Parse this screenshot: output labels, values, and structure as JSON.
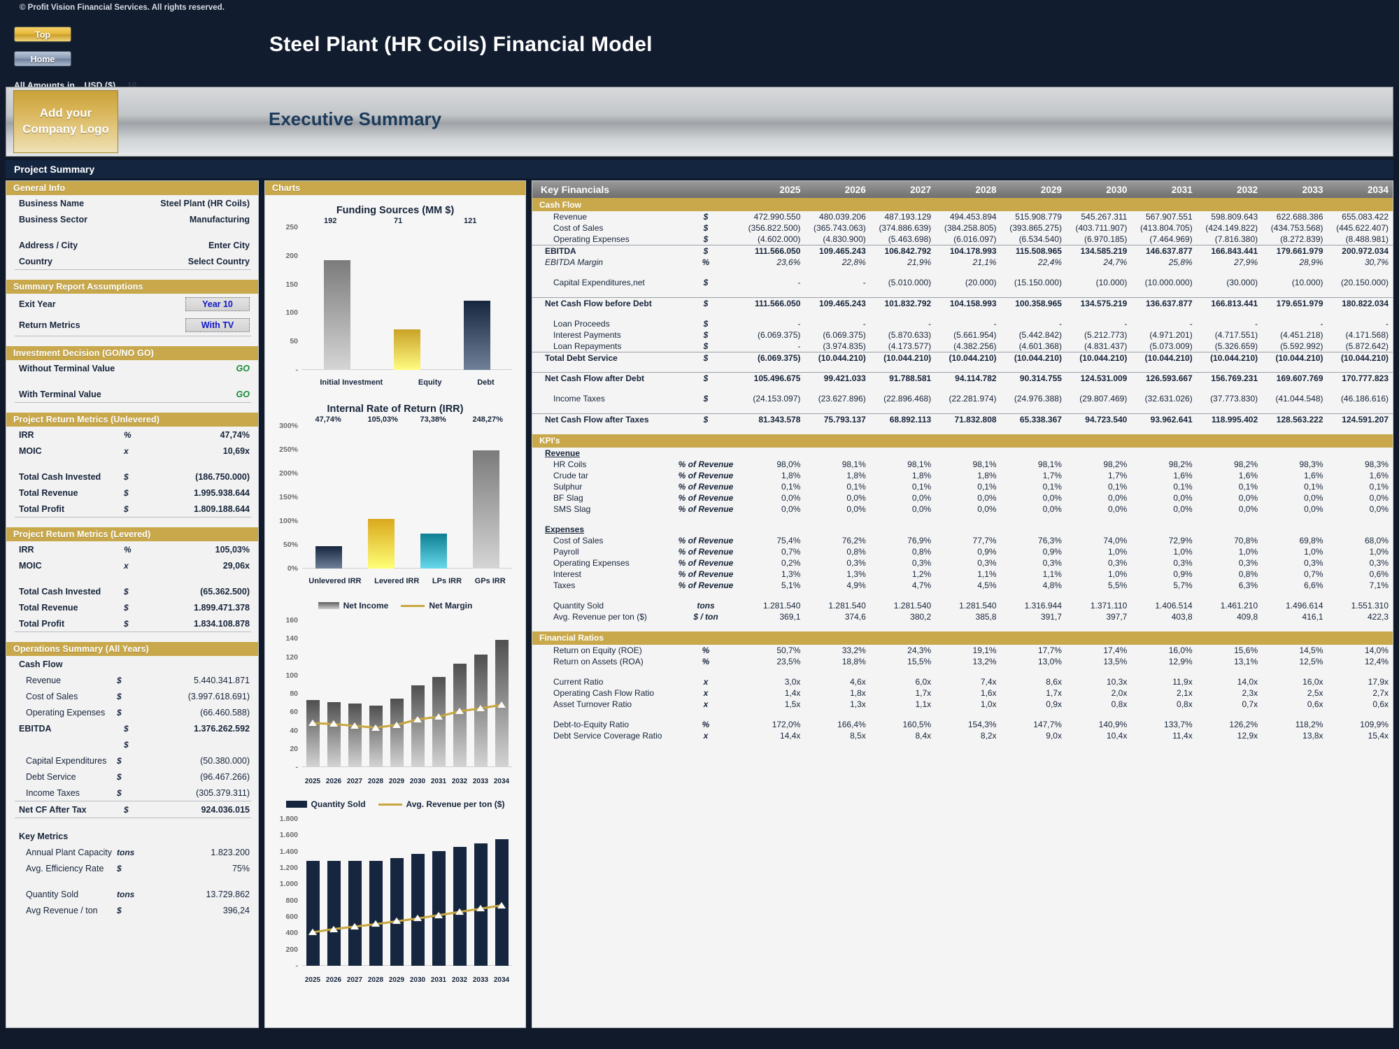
{
  "meta": {
    "copyright": "© Profit Vision Financial Services. All rights reserved.",
    "main_title": "Steel Plant (HR Coils) Financial Model",
    "banner_title": "Executive Summary",
    "logo_line1": "Add your",
    "logo_line2": "Company Logo",
    "amounts_label": "All Amounts in",
    "amounts_value": "USD ($)",
    "amounts_ghost": "10",
    "btn_top": "Top",
    "btn_home": "Home",
    "project_summary": "Project Summary"
  },
  "left": {
    "general_info": {
      "title": "General Info",
      "rows": [
        {
          "label": "Business Name",
          "value": "Steel Plant (HR Coils)"
        },
        {
          "label": "Business Sector",
          "value": "Manufacturing"
        },
        {
          "label": "Address / City",
          "value": "Enter City"
        },
        {
          "label": "Country",
          "value": "Select Country"
        }
      ]
    },
    "assumptions": {
      "title": "Summary  Report Assumptions",
      "exit_year_label": "Exit Year",
      "exit_year_value": "Year 10",
      "return_metrics_label": "Return Metrics",
      "return_metrics_value": "With TV"
    },
    "decision": {
      "title": "Investment Decision (GO/NO GO)",
      "rows": [
        {
          "label": "Without Terminal Value",
          "value": "GO"
        },
        {
          "label": "With Terminal Value",
          "value": "GO"
        }
      ]
    },
    "unlevered": {
      "title": "Project Return Metrics (Unlevered)",
      "rows": [
        {
          "label": "IRR",
          "unit": "%",
          "value": "47,74%"
        },
        {
          "label": "MOIC",
          "unit": "x",
          "value": "10,69x"
        },
        {
          "label": "Total Cash Invested",
          "unit": "$",
          "value": "(186.750.000)"
        },
        {
          "label": "Total Revenue",
          "unit": "$",
          "value": "1.995.938.644"
        },
        {
          "label": "Total Profit",
          "unit": "$",
          "value": "1.809.188.644"
        }
      ]
    },
    "levered": {
      "title": "Project Return Metrics (Levered)",
      "rows": [
        {
          "label": "IRR",
          "unit": "%",
          "value": "105,03%"
        },
        {
          "label": "MOIC",
          "unit": "x",
          "value": "29,06x"
        },
        {
          "label": "Total Cash Invested",
          "unit": "$",
          "value": "(65.362.500)"
        },
        {
          "label": "Total Revenue",
          "unit": "$",
          "value": "1.899.471.378"
        },
        {
          "label": "Total Profit",
          "unit": "$",
          "value": "1.834.108.878"
        }
      ]
    },
    "operations": {
      "title": "Operations Summary (All Years)",
      "cashflow_label": "Cash Flow",
      "cashflow_rows": [
        {
          "label": "Revenue",
          "unit": "$",
          "value": "5.440.341.871"
        },
        {
          "label": "Cost of Sales",
          "unit": "$",
          "value": "(3.997.618.691)"
        },
        {
          "label": "Operating Expenses",
          "unit": "$",
          "value": "(66.460.588)"
        }
      ],
      "ebitda": {
        "label": "EBITDA",
        "unit": "$",
        "value": "1.376.262.592"
      },
      "blank_unit": "$",
      "below_rows": [
        {
          "label": "Capital Expenditures",
          "unit": "$",
          "value": "(50.380.000)"
        },
        {
          "label": "Debt Service",
          "unit": "$",
          "value": "(96.467.266)"
        },
        {
          "label": "Income Taxes",
          "unit": "$",
          "value": "(305.379.311)"
        }
      ],
      "net_cf": {
        "label": "Net CF After Tax",
        "unit": "$",
        "value": "924.036.015"
      },
      "key_metrics_label": "Key Metrics",
      "key_rows": [
        {
          "label": "Annual Plant Capacity",
          "unit": "tons",
          "value": "1.823.200"
        },
        {
          "label": "Avg. Efficiency Rate",
          "unit": "$",
          "value": "75%"
        },
        {
          "label": "Quantity Sold",
          "unit": "tons",
          "value": "13.729.862"
        },
        {
          "label": "Avg Revenue / ton",
          "unit": "$",
          "value": "396,24"
        }
      ]
    }
  },
  "charts_header": "Charts",
  "chart_data": [
    {
      "type": "bar",
      "title": "Funding Sources (MM $)",
      "categories": [
        "Initial Investment",
        "Equity",
        "Debt"
      ],
      "values": [
        192,
        71,
        121
      ],
      "data_labels": [
        "192",
        "71",
        "121"
      ],
      "yticks": [
        "250",
        "200",
        "150",
        "100",
        "50",
        "-"
      ],
      "ylim": [
        0,
        250
      ],
      "colors": [
        "#7b7b7b",
        "#c9a227",
        "#16263f"
      ],
      "xlabel": "",
      "ylabel": "",
      "grid": false,
      "legend": "none"
    },
    {
      "type": "bar",
      "title": "Internal Rate of Return (IRR)",
      "categories": [
        "Unlevered IRR",
        "Levered IRR",
        "LPs IRR",
        "GPs IRR"
      ],
      "values": [
        47.74,
        105.03,
        73.38,
        248.27
      ],
      "data_labels": [
        "47,74%",
        "105,03%",
        "73,38%",
        "248,27%"
      ],
      "yticks": [
        "300%",
        "250%",
        "200%",
        "150%",
        "100%",
        "50%",
        "0%"
      ],
      "ylim": [
        0,
        300
      ],
      "colors": [
        "#16263f",
        "#d9a81d",
        "#0e7f92",
        "#7b7b7b"
      ],
      "xlabel": "",
      "ylabel": "",
      "grid": false,
      "legend": "none"
    },
    {
      "type": "bar+line",
      "title": "",
      "categories": [
        "2025",
        "2026",
        "2027",
        "2028",
        "2029",
        "2030",
        "2031",
        "2032",
        "2033",
        "2034"
      ],
      "series": [
        {
          "name": "Net Income",
          "type": "bar",
          "values": [
            73,
            71,
            69,
            67,
            75,
            89,
            98,
            113,
            123,
            139
          ]
        },
        {
          "name": "Net Margin",
          "type": "line",
          "values": [
            48,
            47,
            45,
            43,
            46,
            52,
            55,
            61,
            64,
            68
          ]
        }
      ],
      "yticks": [
        "160",
        "140",
        "120",
        "100",
        "80",
        "60",
        "40",
        "20",
        "-"
      ],
      "ylim": [
        0,
        160
      ],
      "legend": "top"
    },
    {
      "type": "bar+line",
      "title": "",
      "categories": [
        "2025",
        "2026",
        "2027",
        "2028",
        "2029",
        "2030",
        "2031",
        "2032",
        "2033",
        "2034"
      ],
      "series": [
        {
          "name": "Quantity Sold",
          "type": "bar",
          "values": [
            1282,
            1282,
            1282,
            1282,
            1317,
            1371,
            1407,
            1461,
            1497,
            1551
          ]
        },
        {
          "name": "Avg. Revenue per ton ($)",
          "type": "line",
          "values": [
            410,
            450,
            480,
            510,
            545,
            580,
            620,
            660,
            700,
            740
          ]
        }
      ],
      "yticks": [
        "1.800",
        "1.600",
        "1.400",
        "1.200",
        "1.000",
        "800",
        "600",
        "400",
        "200",
        "-"
      ],
      "ylim": [
        0,
        1800
      ],
      "legend": "top"
    }
  ],
  "right": {
    "title": "Key Financials",
    "years": [
      "2025",
      "2026",
      "2027",
      "2028",
      "2029",
      "2030",
      "2031",
      "2032",
      "2033",
      "2034"
    ],
    "cashflow_title": "Cash Flow",
    "cashflow": [
      {
        "label": "Revenue",
        "unit": "$",
        "bold": false,
        "values": [
          "472.990.550",
          "480.039.206",
          "487.193.129",
          "494.453.894",
          "515.908.779",
          "545.267.311",
          "567.907.551",
          "598.809.643",
          "622.688.386",
          "655.083.422"
        ]
      },
      {
        "label": "Cost of Sales",
        "unit": "$",
        "bold": false,
        "values": [
          "(356.822.500)",
          "(365.743.063)",
          "(374.886.639)",
          "(384.258.805)",
          "(393.865.275)",
          "(403.711.907)",
          "(413.804.705)",
          "(424.149.822)",
          "(434.753.568)",
          "(445.622.407)"
        ]
      },
      {
        "label": "Operating Expenses",
        "unit": "$",
        "bold": false,
        "values": [
          "(4.602.000)",
          "(4.830.900)",
          "(5.463.698)",
          "(6.016.097)",
          "(6.534.540)",
          "(6.970.185)",
          "(7.464.969)",
          "(7.816.380)",
          "(8.272.839)",
          "(8.488.981)"
        ]
      },
      {
        "label": "EBITDA",
        "unit": "$",
        "bold": true,
        "rule": "top",
        "values": [
          "111.566.050",
          "109.465.243",
          "106.842.792",
          "104.178.993",
          "115.508.965",
          "134.585.219",
          "146.637.877",
          "166.843.441",
          "179.661.979",
          "200.972.034"
        ]
      },
      {
        "label": "EBITDA Margin",
        "unit": "%",
        "teal": true,
        "values": [
          "23,6%",
          "22,8%",
          "21,9%",
          "21,1%",
          "22,4%",
          "24,7%",
          "25,8%",
          "27,9%",
          "28,9%",
          "30,7%"
        ]
      },
      {
        "label": "Capital Expenditures,net",
        "unit": "$",
        "bold": false,
        "values": [
          "-",
          "-",
          "(5.010.000)",
          "(20.000)",
          "(15.150.000)",
          "(10.000)",
          "(10.000.000)",
          "(30.000)",
          "(10.000)",
          "(20.150.000)"
        ]
      },
      {
        "label": "Net Cash Flow before Debt",
        "unit": "$",
        "bold": true,
        "rule": "top",
        "values": [
          "111.566.050",
          "109.465.243",
          "101.832.792",
          "104.158.993",
          "100.358.965",
          "134.575.219",
          "136.637.877",
          "166.813.441",
          "179.651.979",
          "180.822.034"
        ]
      },
      {
        "label": "Loan Proceeds",
        "unit": "$",
        "bold": false,
        "values": [
          "-",
          "-",
          "-",
          "-",
          "-",
          "-",
          "-",
          "-",
          "-",
          "-"
        ]
      },
      {
        "label": "Interest Payments",
        "unit": "$",
        "bold": false,
        "values": [
          "(6.069.375)",
          "(6.069.375)",
          "(5.870.633)",
          "(5.661.954)",
          "(5.442.842)",
          "(5.212.773)",
          "(4.971.201)",
          "(4.717.551)",
          "(4.451.218)",
          "(4.171.568)"
        ]
      },
      {
        "label": "Loan Repayments",
        "unit": "$",
        "bold": false,
        "values": [
          "-",
          "(3.974.835)",
          "(4.173.577)",
          "(4.382.256)",
          "(4.601.368)",
          "(4.831.437)",
          "(5.073.009)",
          "(5.326.659)",
          "(5.592.992)",
          "(5.872.642)"
        ]
      },
      {
        "label": "Total Debt Service",
        "unit": "$",
        "bold": true,
        "rule": "top",
        "values": [
          "(6.069.375)",
          "(10.044.210)",
          "(10.044.210)",
          "(10.044.210)",
          "(10.044.210)",
          "(10.044.210)",
          "(10.044.210)",
          "(10.044.210)",
          "(10.044.210)",
          "(10.044.210)"
        ]
      },
      {
        "label": "Net Cash Flow after Debt",
        "unit": "$",
        "bold": true,
        "rule": "top",
        "values": [
          "105.496.675",
          "99.421.033",
          "91.788.581",
          "94.114.782",
          "90.314.755",
          "124.531.009",
          "126.593.667",
          "156.769.231",
          "169.607.769",
          "170.777.823"
        ]
      },
      {
        "label": "Income Taxes",
        "unit": "$",
        "bold": false,
        "values": [
          "(24.153.097)",
          "(23.627.896)",
          "(22.896.468)",
          "(22.281.974)",
          "(24.976.388)",
          "(29.807.469)",
          "(32.631.026)",
          "(37.773.830)",
          "(41.044.548)",
          "(46.186.616)"
        ]
      },
      {
        "label": "Net Cash Flow after Taxes",
        "unit": "$",
        "bold": true,
        "rule": "top",
        "values": [
          "81.343.578",
          "75.793.137",
          "68.892.113",
          "71.832.808",
          "65.338.367",
          "94.723.540",
          "93.962.641",
          "118.995.402",
          "128.563.222",
          "124.591.207"
        ]
      }
    ],
    "kpi_title": "KPI's",
    "kpi_revenue_label": "Revenue",
    "kpi_revenue": [
      {
        "label": "HR Coils",
        "unit": "% of Revenue",
        "values": [
          "98,0%",
          "98,1%",
          "98,1%",
          "98,1%",
          "98,1%",
          "98,2%",
          "98,2%",
          "98,2%",
          "98,3%",
          "98,3%"
        ]
      },
      {
        "label": "Crude tar",
        "unit": "% of Revenue",
        "values": [
          "1,8%",
          "1,8%",
          "1,8%",
          "1,8%",
          "1,7%",
          "1,7%",
          "1,6%",
          "1,6%",
          "1,6%",
          "1,6%"
        ]
      },
      {
        "label": "Sulphur",
        "unit": "% of Revenue",
        "values": [
          "0,1%",
          "0,1%",
          "0,1%",
          "0,1%",
          "0,1%",
          "0,1%",
          "0,1%",
          "0,1%",
          "0,1%",
          "0,1%"
        ]
      },
      {
        "label": "BF Slag",
        "unit": "% of Revenue",
        "values": [
          "0,0%",
          "0,0%",
          "0,0%",
          "0,0%",
          "0,0%",
          "0,0%",
          "0,0%",
          "0,0%",
          "0,0%",
          "0,0%"
        ]
      },
      {
        "label": "SMS Slag",
        "unit": "% of Revenue",
        "values": [
          "0,0%",
          "0,0%",
          "0,0%",
          "0,0%",
          "0,0%",
          "0,0%",
          "0,0%",
          "0,0%",
          "0,0%",
          "0,0%"
        ]
      }
    ],
    "kpi_expenses_label": "Expenses",
    "kpi_expenses": [
      {
        "label": "Cost of Sales",
        "unit": "% of Revenue",
        "values": [
          "75,4%",
          "76,2%",
          "76,9%",
          "77,7%",
          "76,3%",
          "74,0%",
          "72,9%",
          "70,8%",
          "69,8%",
          "68,0%"
        ]
      },
      {
        "label": "Payroll",
        "unit": "% of Revenue",
        "values": [
          "0,7%",
          "0,8%",
          "0,8%",
          "0,9%",
          "0,9%",
          "1,0%",
          "1,0%",
          "1,0%",
          "1,0%",
          "1,0%"
        ]
      },
      {
        "label": "Operating Expenses",
        "unit": "% of Revenue",
        "values": [
          "0,2%",
          "0,3%",
          "0,3%",
          "0,3%",
          "0,3%",
          "0,3%",
          "0,3%",
          "0,3%",
          "0,3%",
          "0,3%"
        ]
      },
      {
        "label": "Interest",
        "unit": "% of Revenue",
        "values": [
          "1,3%",
          "1,3%",
          "1,2%",
          "1,1%",
          "1,1%",
          "1,0%",
          "0,9%",
          "0,8%",
          "0,7%",
          "0,6%"
        ]
      },
      {
        "label": "Taxes",
        "unit": "% of Revenue",
        "values": [
          "5,1%",
          "4,9%",
          "4,7%",
          "4,5%",
          "4,8%",
          "5,5%",
          "5,7%",
          "6,3%",
          "6,6%",
          "7,1%"
        ]
      }
    ],
    "kpi_volume": [
      {
        "label": "Quantity Sold",
        "unit": "tons",
        "values": [
          "1.281.540",
          "1.281.540",
          "1.281.540",
          "1.281.540",
          "1.316.944",
          "1.371.110",
          "1.406.514",
          "1.461.210",
          "1.496.614",
          "1.551.310"
        ]
      },
      {
        "label": "Avg. Revenue per ton ($)",
        "unit": "$ / ton",
        "values": [
          "369,1",
          "374,6",
          "380,2",
          "385,8",
          "391,7",
          "397,7",
          "403,8",
          "409,8",
          "416,1",
          "422,3"
        ]
      }
    ],
    "ratios_title": "Financial Ratios",
    "ratios_a": [
      {
        "label": "Return on Equity (ROE)",
        "unit": "%",
        "values": [
          "50,7%",
          "33,2%",
          "24,3%",
          "19,1%",
          "17,7%",
          "17,4%",
          "16,0%",
          "15,6%",
          "14,5%",
          "14,0%"
        ]
      },
      {
        "label": "Return on Assets (ROA)",
        "unit": "%",
        "values": [
          "23,5%",
          "18,8%",
          "15,5%",
          "13,2%",
          "13,0%",
          "13,5%",
          "12,9%",
          "13,1%",
          "12,5%",
          "12,4%"
        ]
      }
    ],
    "ratios_b": [
      {
        "label": "Current Ratio",
        "unit": "x",
        "values": [
          "3,0x",
          "4,6x",
          "6,0x",
          "7,4x",
          "8,6x",
          "10,3x",
          "11,9x",
          "14,0x",
          "16,0x",
          "17,9x"
        ]
      },
      {
        "label": "Operating Cash Flow Ratio",
        "unit": "x",
        "values": [
          "1,4x",
          "1,8x",
          "1,7x",
          "1,6x",
          "1,7x",
          "2,0x",
          "2,1x",
          "2,3x",
          "2,5x",
          "2,7x"
        ]
      },
      {
        "label": "Asset Turnover Ratio",
        "unit": "x",
        "values": [
          "1,5x",
          "1,3x",
          "1,1x",
          "1,0x",
          "0,9x",
          "0,8x",
          "0,8x",
          "0,7x",
          "0,6x",
          "0,6x"
        ]
      }
    ],
    "ratios_c": [
      {
        "label": "Debt-to-Equity Ratio",
        "unit": "%",
        "values": [
          "172,0%",
          "166,4%",
          "160,5%",
          "154,3%",
          "147,7%",
          "140,9%",
          "133,7%",
          "126,2%",
          "118,2%",
          "109,9%"
        ]
      },
      {
        "label": "Debt Service Coverage Ratio",
        "unit": "x",
        "values": [
          "14,4x",
          "8,5x",
          "8,4x",
          "8,2x",
          "9,0x",
          "10,4x",
          "11,4x",
          "12,9x",
          "13,8x",
          "15,4x"
        ]
      }
    ]
  }
}
